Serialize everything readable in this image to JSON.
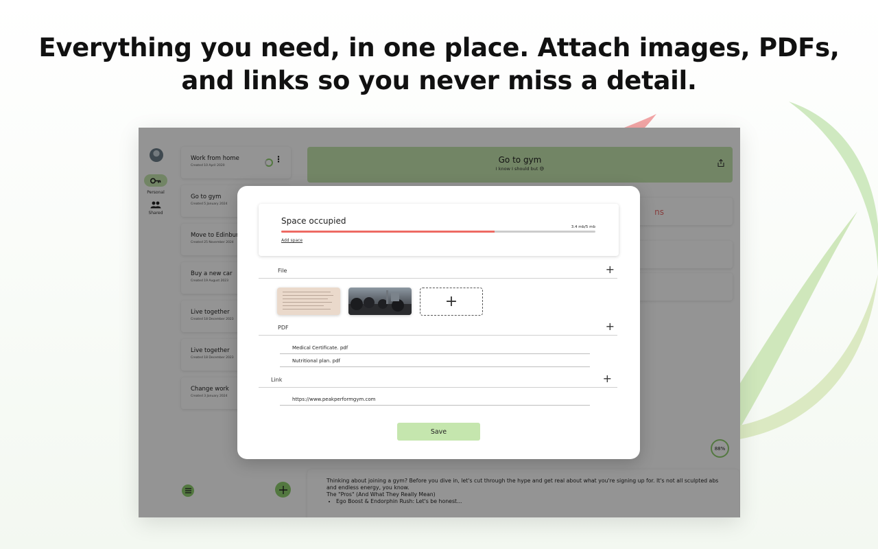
{
  "headline": {
    "line1": "Everything you need, in one place. Attach images, PDFs,",
    "line2": "and links so you never miss a detail."
  },
  "colors": {
    "accent_green": "#c5e6ae",
    "ring_green": "#8fcf6e",
    "warning_red": "#ee6a63"
  },
  "rail": {
    "personal_label": "Personal",
    "shared_label": "Shared",
    "personal_icon": "key-icon",
    "shared_icon": "people-icon"
  },
  "notes": [
    {
      "title": "Work from home",
      "date": "Created 10 April 2020"
    },
    {
      "title": "Go to gym",
      "date": "Created 5 January 2024"
    },
    {
      "title": "Move to Edinburgh",
      "date": "Created 25 November 2024"
    },
    {
      "title": "Buy a new car",
      "date": "Created 19 August 2023"
    },
    {
      "title": "Live together",
      "date": "Created 18 December 2023"
    },
    {
      "title": "Live together",
      "date": "Created 18 December 2023"
    },
    {
      "title": "Change work",
      "date": "Created 3 January 2024"
    }
  ],
  "goal": {
    "title": "Go to gym",
    "subtitle": "I know I should but 😅",
    "partial_text": "ns"
  },
  "progress_label": "88%",
  "description": {
    "para": "Thinking about joining a gym? Before you dive in, let's cut through the hype and get real about what you're signing up for. It's not all sculpted abs and endless energy, you know.",
    "heading": "The \"Pros\" (And What They Really Mean)",
    "bullet": "Ego Boost & Endorphin Rush: Let's be honest..."
  },
  "modal": {
    "space_title": "Space occupied",
    "space_size": "3.4 mb/5 mb",
    "space_fraction": 0.68,
    "add_space": "Add space",
    "file_label": "File",
    "pdf_label": "PDF",
    "link_label": "Link",
    "add_symbol": "+",
    "pdfs": [
      "Medical Certificate. pdf",
      "Nutritional plan. pdf"
    ],
    "links": [
      "https://www.peakperformgym.com"
    ],
    "save": "Save"
  }
}
